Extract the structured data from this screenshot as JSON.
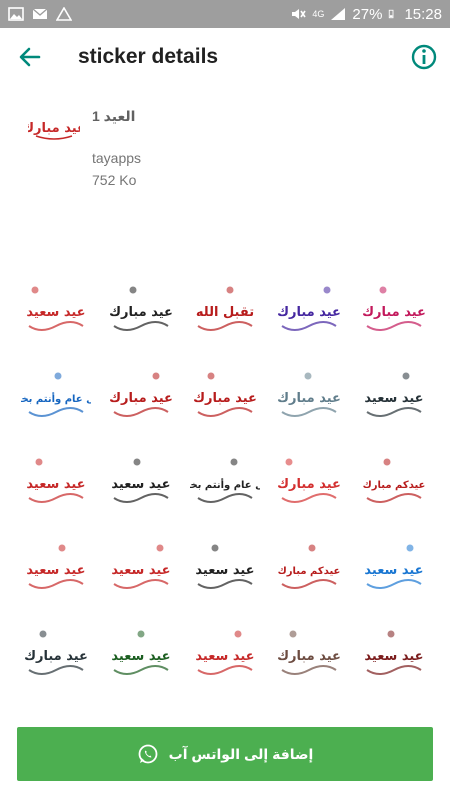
{
  "statusbar": {
    "battery": "27%",
    "time": "15:28",
    "network": "4G"
  },
  "appbar": {
    "title": "sticker details"
  },
  "pack": {
    "name": "العيد 1",
    "author": "tayapps",
    "size": "752 Ko",
    "icon_text": "عيد مبارك"
  },
  "stickers": [
    {
      "text": "عيد سعيد",
      "color": "#c62828"
    },
    {
      "text": "عيد مبارك",
      "color": "#212121"
    },
    {
      "text": "تقبل الله",
      "color": "#b71c1c"
    },
    {
      "text": "عيد مبارك",
      "color": "#4527a0"
    },
    {
      "text": "عيد مبارك",
      "color": "#c2185b"
    },
    {
      "text": "كل عام وأنتم بخير",
      "color": "#1565c0"
    },
    {
      "text": "عيد مبارك",
      "color": "#b71c1c"
    },
    {
      "text": "عيد مبارك",
      "color": "#b71c1c"
    },
    {
      "text": "عيد مبارك",
      "color": "#607d8b"
    },
    {
      "text": "عيد سعيد",
      "color": "#263238"
    },
    {
      "text": "عيد سعيد",
      "color": "#c62828"
    },
    {
      "text": "عيد سعيد",
      "color": "#212121"
    },
    {
      "text": "كل عام وأنتم بخير",
      "color": "#212121"
    },
    {
      "text": "عيد مبارك",
      "color": "#d32f2f"
    },
    {
      "text": "عيدكم مبارك",
      "color": "#b71c1c"
    },
    {
      "text": "عيد سعيد",
      "color": "#c62828"
    },
    {
      "text": "عيد سعيد",
      "color": "#c62828"
    },
    {
      "text": "عيد سعيد",
      "color": "#212121"
    },
    {
      "text": "عيدكم مبارك",
      "color": "#b71c1c"
    },
    {
      "text": "عيد سعيد",
      "color": "#1976d2"
    },
    {
      "text": "عيد مبارك",
      "color": "#263238"
    },
    {
      "text": "عيد سعيد",
      "color": "#1b5e20"
    },
    {
      "text": "عيد سعيد",
      "color": "#c62828"
    },
    {
      "text": "عيد مبارك",
      "color": "#6d4c41"
    },
    {
      "text": "عيد سعيد",
      "color": "#7b1c1c"
    }
  ],
  "footer": {
    "add_label": "إضافة إلى الواتس آب"
  },
  "colors": {
    "accent": "#00897b",
    "button": "#4caf50",
    "statusbar": "#9e9e9e"
  }
}
